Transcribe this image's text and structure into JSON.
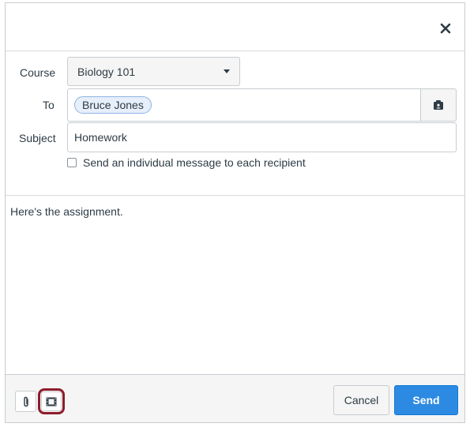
{
  "form": {
    "course_label": "Course",
    "course_value": "Biology 101",
    "to_label": "To",
    "recipients": [
      "Bruce Jones"
    ],
    "subject_label": "Subject",
    "subject_value": "Homework",
    "individual_message_label": "Send an individual message to each recipient",
    "individual_message_checked": false
  },
  "message": {
    "body": "Here's the assignment."
  },
  "footer": {
    "cancel_label": "Cancel",
    "send_label": "Send"
  },
  "icons": {
    "close": "close-icon",
    "address_book": "address-book-icon",
    "attach": "paperclip-icon",
    "media": "film-icon"
  },
  "colors": {
    "send_button": "#2d8ae2",
    "highlight": "#8e1c2a",
    "token_bg": "#e6effa"
  }
}
